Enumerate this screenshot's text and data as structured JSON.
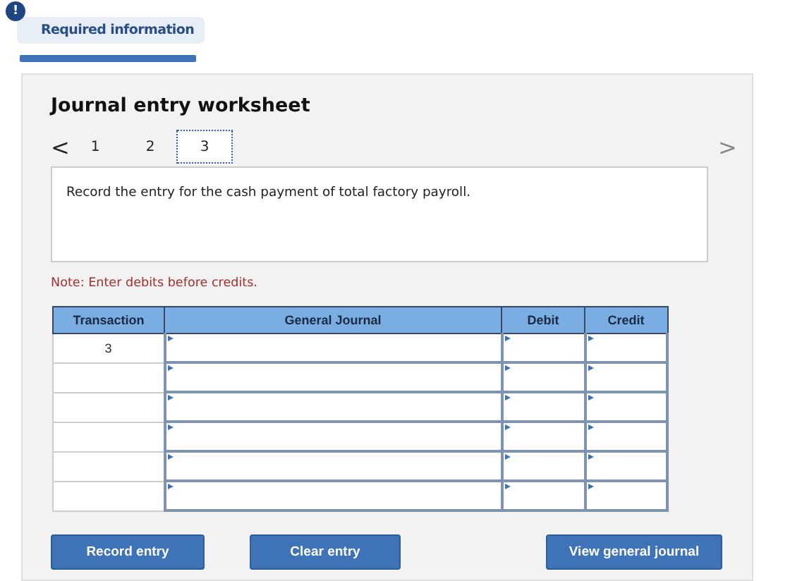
{
  "required_tab": {
    "icon": "!",
    "label": "Required information"
  },
  "worksheet": {
    "title": "Journal entry worksheet",
    "prev": "<",
    "next": ">",
    "pages": [
      {
        "label": "1",
        "selected": false
      },
      {
        "label": "2",
        "selected": false
      },
      {
        "label": "3",
        "selected": true
      }
    ],
    "prompt": "Record the entry for the cash payment of total factory payroll.",
    "note": "Note: Enter debits before credits.",
    "table": {
      "columns": [
        "Transaction",
        "General Journal",
        "Debit",
        "Credit"
      ],
      "rows": [
        {
          "transaction": "3"
        },
        {},
        {},
        {},
        {},
        {}
      ]
    },
    "buttons": [
      "Record entry",
      "Clear entry",
      "View general journal"
    ]
  }
}
